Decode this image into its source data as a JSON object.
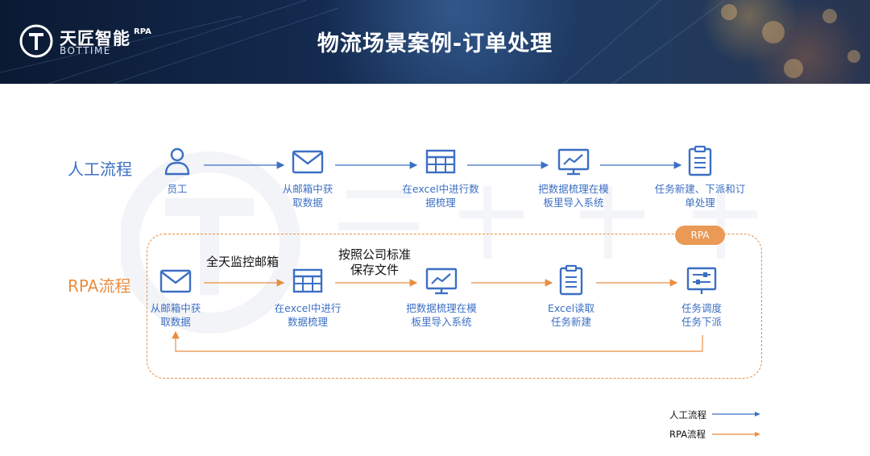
{
  "header": {
    "logo_cn": "天匠智能",
    "logo_rpa": "RPA",
    "logo_en": "BOTTIME",
    "title": "物流场景案例-订单处理"
  },
  "manual": {
    "label": "人工流程",
    "nodes": [
      {
        "icon": "person-icon",
        "label_lines": [
          "员工"
        ]
      },
      {
        "icon": "mail-icon",
        "label_lines": [
          "从邮箱中获",
          "取数据"
        ]
      },
      {
        "icon": "table-icon",
        "label_lines": [
          "在excel中进行数",
          "据梳理"
        ]
      },
      {
        "icon": "monitor-chart-icon",
        "label_lines": [
          "把数据梳理在模",
          "板里导入系统"
        ]
      },
      {
        "icon": "clipboard-icon",
        "label_lines": [
          "任务新建、下派和订",
          "单处理"
        ]
      }
    ]
  },
  "rpa": {
    "label": "RPA流程",
    "badge": "RPA",
    "annotation_1": "全天监控邮箱",
    "annotation_2_lines": [
      "按照公司标准",
      "保存文件"
    ],
    "nodes": [
      {
        "icon": "mail-icon",
        "label_lines": [
          "从邮箱中获",
          "取数据"
        ]
      },
      {
        "icon": "table-icon",
        "label_lines": [
          "在excel中进行",
          "数据梳理"
        ]
      },
      {
        "icon": "monitor-chart-icon",
        "label_lines": [
          "把数据梳理在模",
          "板里导入系统"
        ]
      },
      {
        "icon": "clipboard-icon",
        "label_lines": [
          "Excel读取",
          "任务新建"
        ]
      },
      {
        "icon": "dispatch-icon",
        "label_lines": [
          "任务调度",
          "任务下派"
        ]
      }
    ]
  },
  "legend": {
    "manual_label": "人工流程",
    "rpa_label": "RPA流程"
  },
  "colors": {
    "manual": "#3c6fc4",
    "rpa": "#e98e42",
    "badge": "#ea9a55"
  }
}
